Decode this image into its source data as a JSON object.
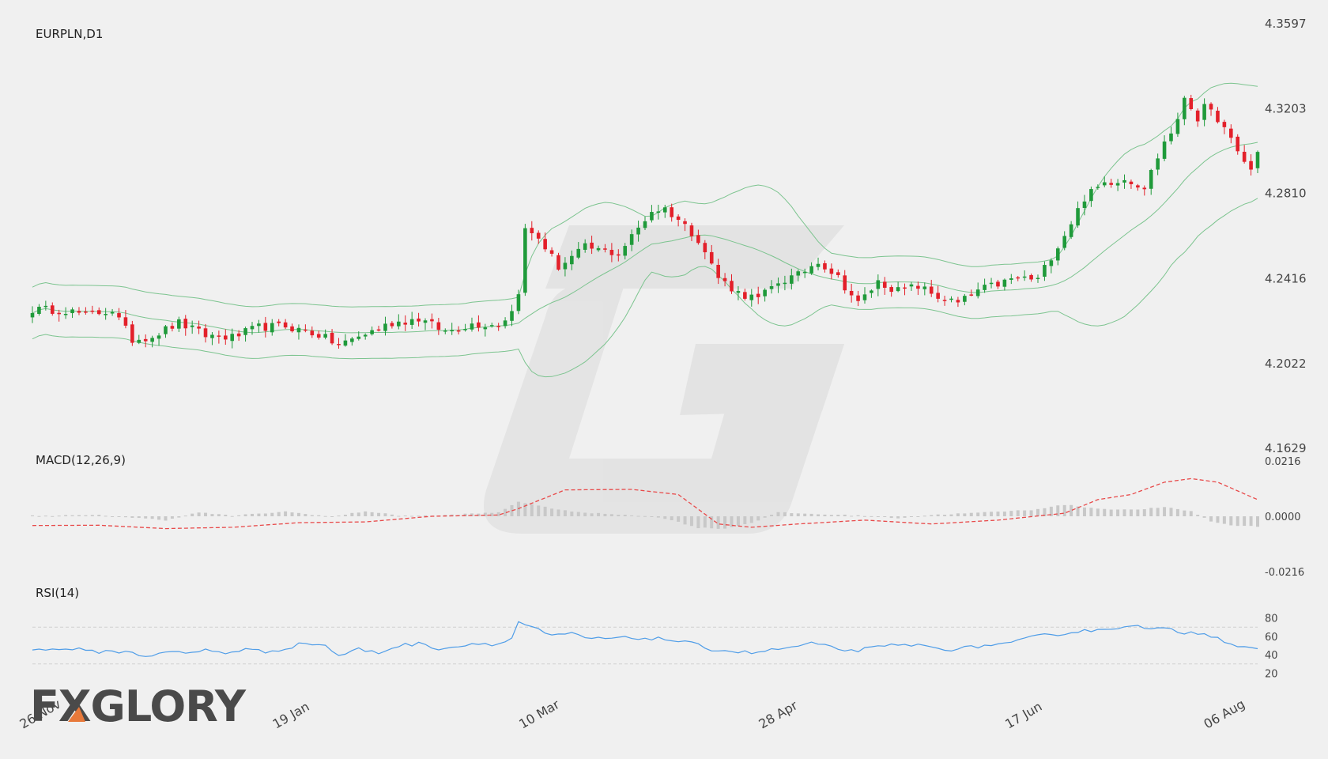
{
  "chart_data": {
    "type": "candlestick",
    "symbol_label": "EURPLN,D1",
    "price_axis": {
      "ticks": [
        "4.3597",
        "4.3203",
        "4.2810",
        "4.2416",
        "4.2022",
        "4.1629"
      ],
      "range": [
        4.1629,
        4.3597
      ]
    },
    "x_ticks": [
      "26 Nov",
      "19 Jan",
      "10 Mar",
      "28 Apr",
      "17 Jun",
      "06 Aug"
    ],
    "x_tick_index": [
      0,
      38,
      75,
      111,
      148,
      184
    ],
    "bars": 185,
    "close_anchors": [
      [
        0,
        4.2272
      ],
      [
        5,
        4.227
      ],
      [
        8,
        4.2246
      ],
      [
        12,
        4.227
      ],
      [
        15,
        4.2132
      ],
      [
        18,
        4.215
      ],
      [
        22,
        4.221
      ],
      [
        26,
        4.2152
      ],
      [
        30,
        4.2143
      ],
      [
        34,
        4.219
      ],
      [
        38,
        4.2195
      ],
      [
        43,
        4.2155
      ],
      [
        46,
        4.2107
      ],
      [
        50,
        4.216
      ],
      [
        54,
        4.221
      ],
      [
        58,
        4.223
      ],
      [
        62,
        4.217
      ],
      [
        66,
        4.2205
      ],
      [
        70,
        4.2202
      ],
      [
        72,
        4.2262
      ],
      [
        73,
        4.236
      ],
      [
        74,
        4.264
      ],
      [
        76,
        4.2605
      ],
      [
        79,
        4.247
      ],
      [
        83,
        4.256
      ],
      [
        88,
        4.253
      ],
      [
        93,
        4.273
      ],
      [
        95,
        4.274
      ],
      [
        97,
        4.269
      ],
      [
        100,
        4.26
      ],
      [
        103,
        4.242
      ],
      [
        106,
        4.235
      ],
      [
        109,
        4.232
      ],
      [
        112,
        4.24
      ],
      [
        115,
        4.243
      ],
      [
        118,
        4.25
      ],
      [
        121,
        4.242
      ],
      [
        124,
        4.23
      ],
      [
        127,
        4.24
      ],
      [
        130,
        4.236
      ],
      [
        133,
        4.238
      ],
      [
        136,
        4.233
      ],
      [
        139,
        4.23
      ],
      [
        142,
        4.236
      ],
      [
        145,
        4.239
      ],
      [
        148,
        4.242
      ],
      [
        151,
        4.241
      ],
      [
        153,
        4.252
      ],
      [
        155,
        4.262
      ],
      [
        158,
        4.279
      ],
      [
        161,
        4.286
      ],
      [
        164,
        4.288
      ],
      [
        167,
        4.284
      ],
      [
        170,
        4.305
      ],
      [
        172,
        4.314
      ],
      [
        173,
        4.326
      ],
      [
        175,
        4.316
      ],
      [
        176,
        4.3205
      ],
      [
        178,
        4.316
      ],
      [
        181,
        4.3
      ],
      [
        183,
        4.292
      ],
      [
        184,
        4.3
      ]
    ],
    "macd": {
      "label": "MACD(12,26,9)",
      "ticks": [
        "0.0216",
        "0.0000",
        "-0.0216"
      ],
      "range": [
        -0.0216,
        0.0216
      ],
      "signal_anchors": [
        [
          0,
          -0.0036
        ],
        [
          10,
          -0.0035
        ],
        [
          20,
          -0.0048
        ],
        [
          30,
          -0.0043
        ],
        [
          40,
          -0.0025
        ],
        [
          50,
          -0.0022
        ],
        [
          60,
          0.0
        ],
        [
          70,
          0.0005
        ],
        [
          73,
          0.003
        ],
        [
          80,
          0.0103
        ],
        [
          90,
          0.0105
        ],
        [
          97,
          0.0085
        ],
        [
          103,
          -0.003
        ],
        [
          108,
          -0.0043
        ],
        [
          115,
          -0.003
        ],
        [
          125,
          -0.0015
        ],
        [
          135,
          -0.003
        ],
        [
          145,
          -0.0015
        ],
        [
          155,
          0.0012
        ],
        [
          160,
          0.0065
        ],
        [
          165,
          0.0085
        ],
        [
          170,
          0.0133
        ],
        [
          174,
          0.0147
        ],
        [
          178,
          0.0133
        ],
        [
          184,
          0.0065
        ]
      ],
      "hist_anchors": [
        [
          0,
          0.0002
        ],
        [
          10,
          0.0004
        ],
        [
          20,
          -0.0015
        ],
        [
          25,
          0.0015
        ],
        [
          30,
          0.0002
        ],
        [
          38,
          0.0018
        ],
        [
          45,
          -0.0002
        ],
        [
          50,
          0.002
        ],
        [
          55,
          0.0003
        ],
        [
          60,
          0.0002
        ],
        [
          70,
          0.0015
        ],
        [
          73,
          0.0058
        ],
        [
          76,
          0.004
        ],
        [
          82,
          0.0015
        ],
        [
          90,
          0.0005
        ],
        [
          95,
          -0.0008
        ],
        [
          100,
          -0.0045
        ],
        [
          104,
          -0.0048
        ],
        [
          108,
          -0.0025
        ],
        [
          112,
          0.0015
        ],
        [
          118,
          0.0008
        ],
        [
          125,
          0.0002
        ],
        [
          130,
          -0.0007
        ],
        [
          135,
          0.0005
        ],
        [
          143,
          0.0015
        ],
        [
          150,
          0.0025
        ],
        [
          155,
          0.0045
        ],
        [
          160,
          0.003
        ],
        [
          165,
          0.0025
        ],
        [
          170,
          0.0035
        ],
        [
          174,
          0.002
        ],
        [
          177,
          -0.002
        ],
        [
          180,
          -0.0035
        ],
        [
          184,
          -0.004
        ]
      ]
    },
    "rsi": {
      "label": "RSI(14)",
      "ticks": [
        "80",
        "60",
        "40",
        "20"
      ],
      "range": [
        10,
        90
      ],
      "levels": [
        70,
        30
      ],
      "anchors": [
        [
          0,
          47
        ],
        [
          3,
          45
        ],
        [
          6,
          47
        ],
        [
          9,
          43
        ],
        [
          12,
          44
        ],
        [
          15,
          42
        ],
        [
          17,
          38
        ],
        [
          20,
          44
        ],
        [
          23,
          41
        ],
        [
          26,
          45
        ],
        [
          29,
          42
        ],
        [
          32,
          46
        ],
        [
          35,
          43
        ],
        [
          38,
          47
        ],
        [
          41,
          53
        ],
        [
          44,
          50
        ],
        [
          46,
          39
        ],
        [
          49,
          46
        ],
        [
          52,
          42
        ],
        [
          55,
          50
        ],
        [
          58,
          52
        ],
        [
          61,
          47
        ],
        [
          64,
          49
        ],
        [
          67,
          53
        ],
        [
          70,
          51
        ],
        [
          72,
          58
        ],
        [
          73,
          76
        ],
        [
          75,
          70
        ],
        [
          78,
          60
        ],
        [
          81,
          63
        ],
        [
          84,
          57
        ],
        [
          87,
          58
        ],
        [
          90,
          58
        ],
        [
          93,
          58
        ],
        [
          96,
          56
        ],
        [
          99,
          52
        ],
        [
          102,
          46
        ],
        [
          105,
          44
        ],
        [
          108,
          42
        ],
        [
          111,
          45
        ],
        [
          114,
          48
        ],
        [
          117,
          52
        ],
        [
          120,
          48
        ],
        [
          123,
          44
        ],
        [
          126,
          47
        ],
        [
          129,
          50
        ],
        [
          132,
          51
        ],
        [
          135,
          48
        ],
        [
          138,
          46
        ],
        [
          141,
          48
        ],
        [
          144,
          51
        ],
        [
          147,
          52
        ],
        [
          150,
          59
        ],
        [
          153,
          62
        ],
        [
          156,
          64
        ],
        [
          158,
          67
        ],
        [
          160,
          66
        ],
        [
          163,
          70
        ],
        [
          165,
          73
        ],
        [
          167,
          68
        ],
        [
          170,
          68
        ],
        [
          173,
          64
        ],
        [
          176,
          64
        ],
        [
          178,
          58
        ],
        [
          181,
          50
        ],
        [
          184,
          47
        ]
      ]
    }
  }
}
